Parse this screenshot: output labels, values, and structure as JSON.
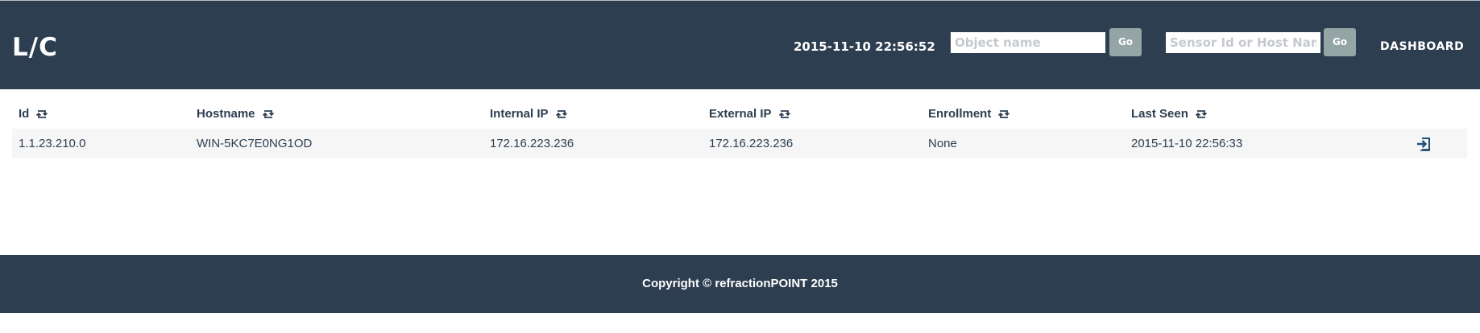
{
  "header": {
    "logo": "L/C",
    "timestamp": "2015-11-10 22:56:52",
    "object_search": {
      "placeholder": "Object name",
      "value": "",
      "button": "Go"
    },
    "sensor_search": {
      "placeholder": "Sensor Id or Host Name",
      "value": "",
      "button": "Go"
    },
    "nav": {
      "dashboard": "DASHBOARD"
    }
  },
  "table": {
    "columns": [
      "Id",
      "Hostname",
      "Internal IP",
      "External IP",
      "Enrollment",
      "Last Seen"
    ],
    "rows": [
      {
        "id": "1.1.23.210.0",
        "hostname": "WIN-5KC7E0NG1OD",
        "internal_ip": "172.16.223.236",
        "external_ip": "172.16.223.236",
        "enrollment": "None",
        "last_seen": "2015-11-10 22:56:33",
        "action_icon": "login-icon"
      }
    ]
  },
  "footer": {
    "copyright": "Copyright © refractionPOINT 2015"
  },
  "colors": {
    "header_bg": "#2d3e50",
    "footer_bg": "#2d3e50",
    "button_bg": "#95a5a6",
    "row_bg": "#f6f6f6",
    "text": "#2d3e50",
    "icon_accent": "#1f4e79"
  }
}
